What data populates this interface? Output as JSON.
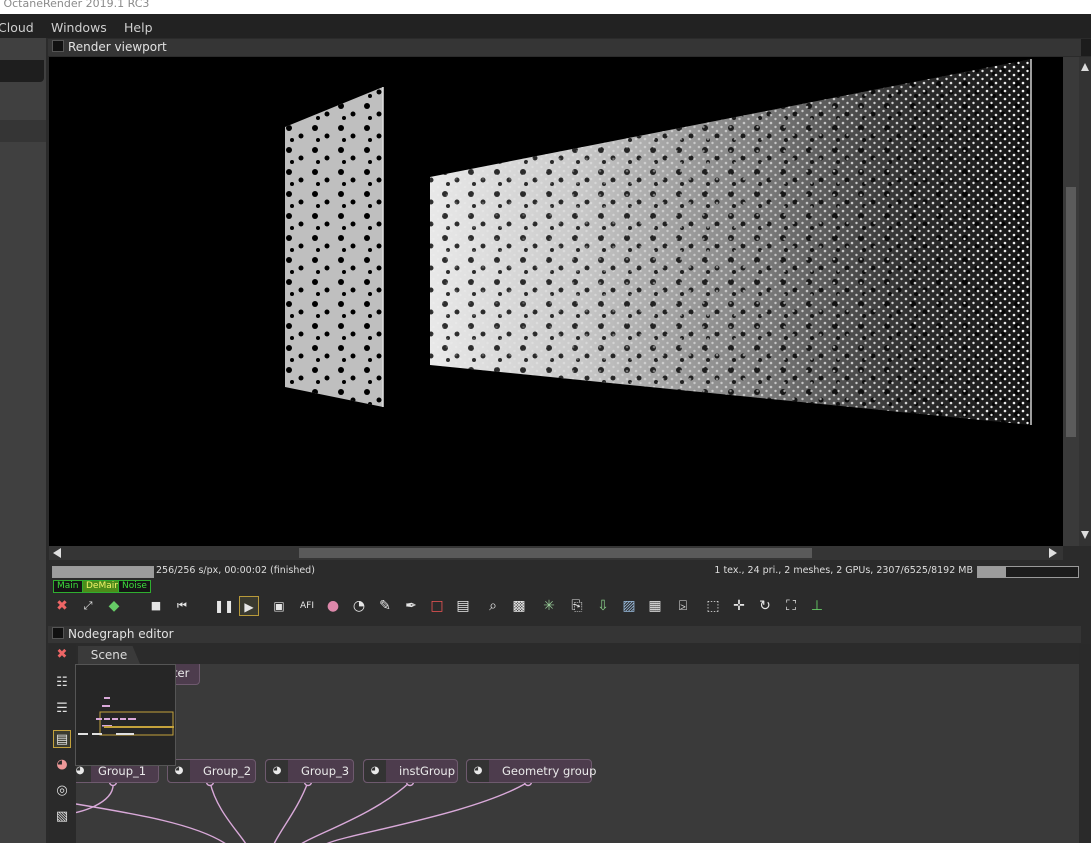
{
  "window": {
    "title": "- OctaneRender 2019.1 RC3"
  },
  "menu": {
    "items": [
      "Cloud",
      "Windows",
      "Help"
    ]
  },
  "render_viewport": {
    "title": "Render viewport",
    "status_left": "256/256 s/px, 00:00:02 (finished)",
    "status_right": "1 tex., 24 pri., 2 meshes, 2 GPUs, 2307/6525/8192 MB",
    "render_progress": 1.0,
    "memory_usage": 0.28,
    "passes": [
      {
        "label": "Main",
        "active": false
      },
      {
        "label": "DeMain",
        "active": true
      },
      {
        "label": "Noise",
        "active": false
      }
    ]
  },
  "toolbar": {
    "icons": [
      "clay-render-icon",
      "region-render-icon",
      "color-cube-icon",
      "stop-icon",
      "restart-icon",
      "pause-icon",
      "play-icon",
      "viewport-lock-icon",
      "afi-icon",
      "color-wheel-icon",
      "material-picker-icon",
      "focus-picker-icon",
      "white-balance-picker-icon",
      "film-region-icon",
      "render-region-icon",
      "zoom-icon",
      "resolution-icon",
      "decal-icon",
      "copy-icon",
      "paste-icon",
      "save-icon",
      "lock-icon",
      "padlock-icon",
      "cube-gizmo-icon",
      "move-gizmo-icon",
      "rotate-gizmo-icon",
      "scale-gizmo-icon",
      "axis-gizmo-icon"
    ],
    "afi_label": "AFI"
  },
  "nodegraph": {
    "title": "Nodegraph editor",
    "tab": "Scene",
    "partial_node": "ter",
    "nodes": [
      "Group_1",
      "Group_2",
      "Group_3",
      "instGroup",
      "Geometry group"
    ]
  },
  "colors": {
    "accent": "#c4a23c",
    "node": "#4d3c4d",
    "wire": "#d9a9d9",
    "pass_green": "#3ddc3d"
  }
}
